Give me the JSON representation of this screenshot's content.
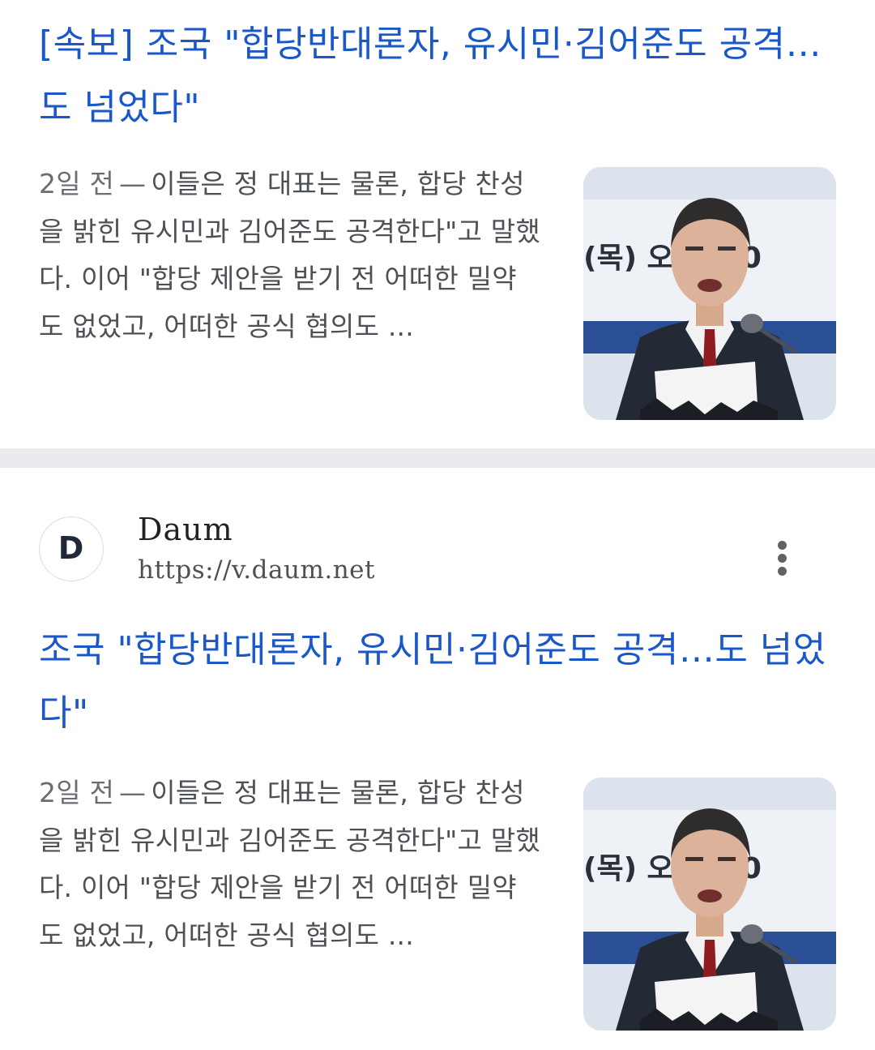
{
  "results": [
    {
      "title": "[속보] 조국 \"합당반대론자, 유시민·김어준도 공격…도 넘었다\"",
      "age": "2일 전",
      "snippet": "이들은 정 대표는 물론, 합당 찬성을 밝힌 유시민과 김어준도 공격한다\"고 말했다. 이어 \"합당 제안을 받기 전 어떠한 밀약도 없었고, 어떠한 공식 협의도 ...",
      "thumbnail_text": "(목) 오      시 30"
    },
    {
      "source": {
        "name": "Daum",
        "url": "https://v.daum.net",
        "favicon_letter": "D"
      },
      "title": "조국 \"합당반대론자, 유시민·김어준도 공격…도 넘었다\"",
      "age": "2일 전",
      "snippet": "이들은 정 대표는 물론, 합당 찬성을 밝힌 유시민과 김어준도 공격한다\"고 말했다. 이어 \"합당 제안을 받기 전 어떠한 밀약도 없었고, 어떠한 공식 협의도 ...",
      "thumbnail_text": "(목) 오      시 30"
    }
  ],
  "icons": {
    "more": "more-vert-icon",
    "favicon": "daum-logo-icon"
  },
  "colors": {
    "title": "#1a57c9",
    "snippet": "#4d5156",
    "divider": "#e9ebee"
  }
}
